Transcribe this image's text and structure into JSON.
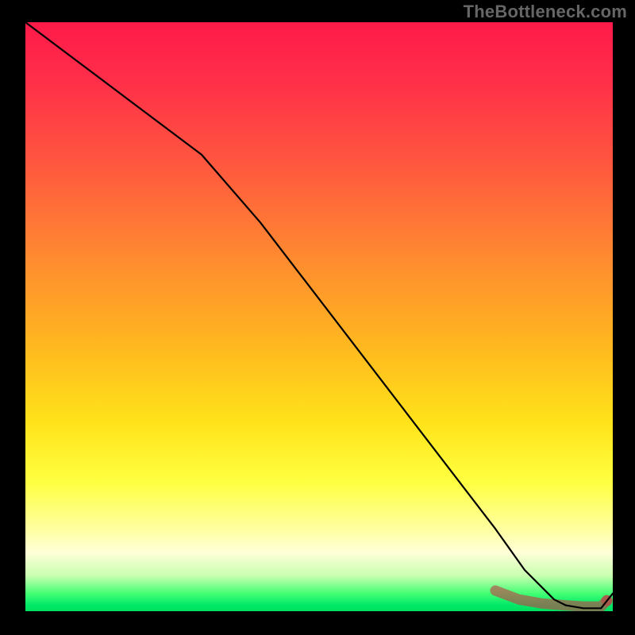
{
  "watermark": "TheBottleneck.com",
  "colors": {
    "background": "#000000",
    "curve": "#000000",
    "ci": "#b84848",
    "gradient_top": "#ff1a49",
    "gradient_mid": "#ffe31a",
    "gradient_bottom": "#00e05e"
  },
  "chart_data": {
    "type": "line",
    "title": "",
    "xlabel": "",
    "ylabel": "",
    "xlim": [
      0,
      100
    ],
    "ylim": [
      0,
      100
    ],
    "grid": false,
    "legend": false,
    "series": [
      {
        "name": "bottleneck_curve",
        "x": [
          0,
          10,
          20,
          30,
          40,
          50,
          60,
          70,
          80,
          85,
          90,
          92,
          95,
          98,
          100
        ],
        "values": [
          100,
          92.5,
          85,
          77.5,
          66,
          53,
          40,
          27,
          14,
          7,
          2,
          1,
          0.5,
          0.5,
          3
        ]
      }
    ],
    "highlight_band": {
      "name": "optimal_range",
      "x": [
        80,
        84,
        88,
        92,
        95,
        98,
        99
      ],
      "values": [
        3.5,
        2.0,
        1.3,
        1.0,
        0.8,
        0.8,
        1.8
      ]
    },
    "annotations": []
  }
}
